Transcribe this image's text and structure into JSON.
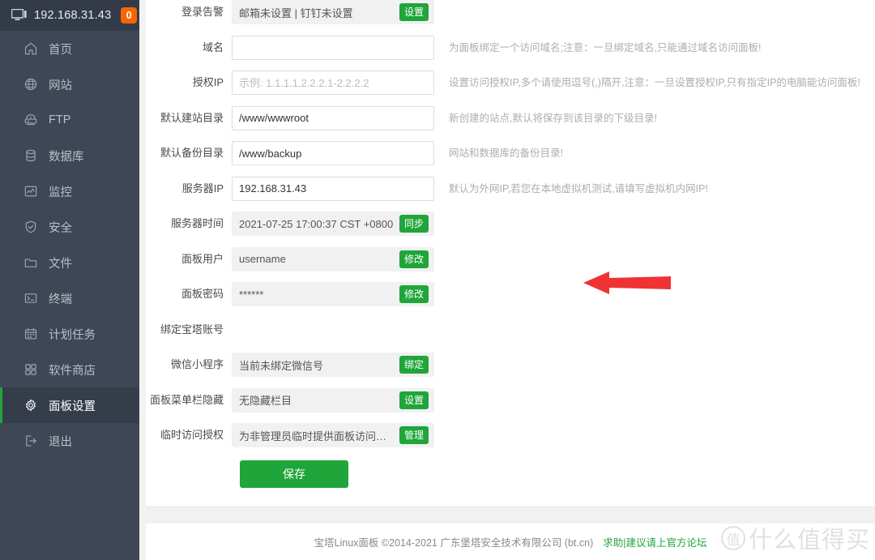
{
  "sidebar": {
    "header": {
      "ip": "192.168.31.43",
      "badge": "0",
      "icon": "monitor-icon"
    },
    "items": [
      {
        "label": "首页",
        "icon": "home-icon",
        "active": false
      },
      {
        "label": "网站",
        "icon": "globe-icon",
        "active": false
      },
      {
        "label": "FTP",
        "icon": "server-icon",
        "active": false
      },
      {
        "label": "数据库",
        "icon": "database-icon",
        "active": false
      },
      {
        "label": "监控",
        "icon": "monitor-chart-icon",
        "active": false
      },
      {
        "label": "安全",
        "icon": "shield-icon",
        "active": false
      },
      {
        "label": "文件",
        "icon": "folder-icon",
        "active": false
      },
      {
        "label": "终端",
        "icon": "terminal-icon",
        "active": false
      },
      {
        "label": "计划任务",
        "icon": "calendar-icon",
        "active": false
      },
      {
        "label": "软件商店",
        "icon": "grid-icon",
        "active": false
      },
      {
        "label": "面板设置",
        "icon": "gear-icon",
        "active": true
      },
      {
        "label": "退出",
        "icon": "logout-icon",
        "active": false
      }
    ]
  },
  "form": {
    "rows": [
      {
        "label": "登录告警",
        "type": "static",
        "value": "邮箱未设置 | 钉钉未设置",
        "button": "设置",
        "help": ""
      },
      {
        "label": "域名",
        "type": "input",
        "value": "",
        "placeholder": "",
        "help": "为面板绑定一个访问域名;注意：一旦绑定域名,只能通过域名访问面板!"
      },
      {
        "label": "授权IP",
        "type": "input",
        "value": "",
        "placeholder": "示例: 1.1.1.1,2.2.2.1-2.2.2.2",
        "help": "设置访问授权IP,多个请使用逗号(,)隔开,注意：一旦设置授权IP,只有指定IP的电脑能访问面板!"
      },
      {
        "label": "默认建站目录",
        "type": "input",
        "value": "/www/wwwroot",
        "placeholder": "",
        "help": "新创建的站点,默认将保存到该目录的下级目录!"
      },
      {
        "label": "默认备份目录",
        "type": "input",
        "value": "/www/backup",
        "placeholder": "",
        "help": "网站和数据库的备份目录!"
      },
      {
        "label": "服务器IP",
        "type": "input",
        "value": "192.168.31.43",
        "placeholder": "",
        "help": "默认为外网IP,若您在本地虚拟机测试,请填写虚拟机内网IP!"
      },
      {
        "label": "服务器时间",
        "type": "static",
        "value": "2021-07-25 17:00:37 CST +0800",
        "button": "同步",
        "help": ""
      },
      {
        "label": "面板用户",
        "type": "static",
        "value": "username",
        "button": "修改",
        "help": ""
      },
      {
        "label": "面板密码",
        "type": "static",
        "value": "******",
        "button": "修改",
        "help": ""
      },
      {
        "label": "绑定宝塔账号",
        "type": "empty",
        "value": "",
        "button": "",
        "help": ""
      },
      {
        "label": "微信小程序",
        "type": "static",
        "value": "当前未绑定微信号",
        "button": "绑定",
        "help": ""
      },
      {
        "label": "面板菜单栏隐藏",
        "type": "static",
        "value": "无隐藏栏目",
        "button": "设置",
        "help": ""
      },
      {
        "label": "临时访问授权",
        "type": "static",
        "value": "为非管理员临时提供面板访问权限",
        "button": "管理",
        "help": ""
      }
    ],
    "save_label": "保存"
  },
  "footer": {
    "text": "宝塔Linux面板 ©2014-2021 广东堡塔安全技术有限公司 (bt.cn)",
    "link": "求助|建议请上官方论坛"
  },
  "watermark": {
    "mark": "值",
    "text": "什么值得买"
  },
  "colors": {
    "accent_green": "#20a53a",
    "sidebar_bg": "#3f4756",
    "sidebar_header_bg": "#333b48",
    "badge_orange": "#f96500",
    "arrow_red": "#f03232",
    "help_text": "#adadad"
  }
}
